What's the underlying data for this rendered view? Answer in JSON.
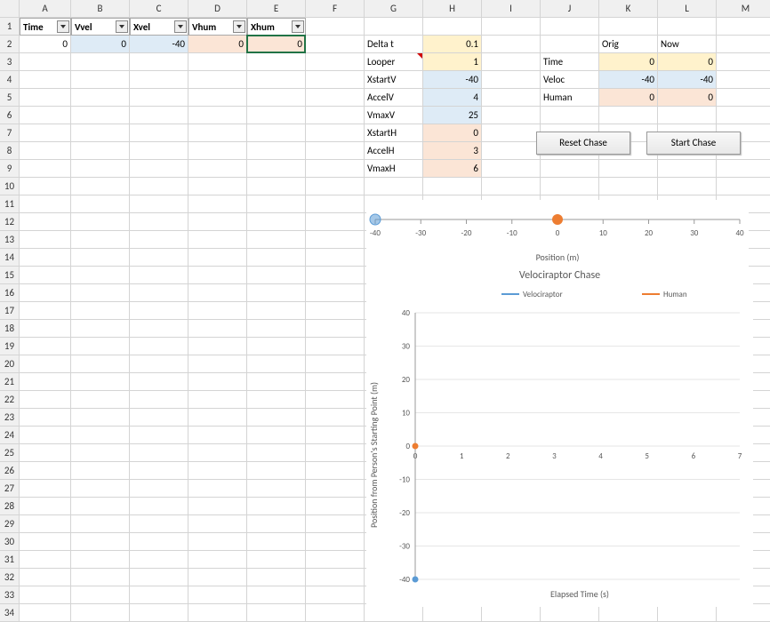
{
  "columns": [
    "A",
    "B",
    "C",
    "D",
    "E",
    "F",
    "G",
    "H",
    "I",
    "J",
    "K",
    "L",
    "M"
  ],
  "table": {
    "headers": [
      "Time",
      "Vvel",
      "Xvel",
      "Vhum",
      "Xhum"
    ],
    "row": [
      0,
      0,
      -40,
      0,
      0
    ]
  },
  "params": {
    "Delta_t": {
      "label": "Delta t",
      "value": 0.1
    },
    "Looper": {
      "label": "Looper",
      "value": 1
    },
    "XstartV": {
      "label": "XstartV",
      "value": -40
    },
    "AccelV": {
      "label": "AccelV",
      "value": 4
    },
    "VmaxV": {
      "label": "VmaxV",
      "value": 25
    },
    "XstartH": {
      "label": "XstartH",
      "value": 0
    },
    "AccelH": {
      "label": "AccelH",
      "value": 3
    },
    "VmaxH": {
      "label": "VmaxH",
      "value": 6
    }
  },
  "state": {
    "orig_label": "Orig",
    "now_label": "Now",
    "rows": [
      {
        "name": "Time",
        "orig": 0,
        "now": 0
      },
      {
        "name": "Veloc",
        "orig": -40,
        "now": -40
      },
      {
        "name": "Human",
        "orig": 0,
        "now": 0
      }
    ]
  },
  "buttons": {
    "reset": "Reset Chase",
    "start": "Start Chase"
  },
  "chart_data": [
    {
      "type": "scatter",
      "xlabel": "Position (m)",
      "xlim": [
        -40,
        40
      ],
      "xticks": [
        -40,
        -30,
        -20,
        -10,
        0,
        10,
        20,
        30,
        40
      ],
      "series": [
        {
          "name": "Velociraptor",
          "x": [
            -40
          ],
          "y": [
            0
          ],
          "color": "#5b9bd5"
        },
        {
          "name": "Human",
          "x": [
            0
          ],
          "y": [
            0
          ],
          "color": "#ed7d31"
        }
      ]
    },
    {
      "type": "scatter",
      "title": "Velociraptor Chase",
      "xlabel": "Elapsed Time (s)",
      "ylabel": "Position from Person's Starting Point (m)",
      "xlim": [
        0,
        7
      ],
      "ylim": [
        -40,
        40
      ],
      "xticks": [
        0,
        1,
        2,
        3,
        4,
        5,
        6,
        7
      ],
      "yticks": [
        -40,
        -30,
        -20,
        -10,
        0,
        10,
        20,
        30,
        40
      ],
      "series": [
        {
          "name": "Velociraptor",
          "x": [
            0
          ],
          "y": [
            -40
          ],
          "color": "#5b9bd5"
        },
        {
          "name": "Human",
          "x": [
            0
          ],
          "y": [
            0
          ],
          "color": "#ed7d31"
        }
      ]
    }
  ]
}
